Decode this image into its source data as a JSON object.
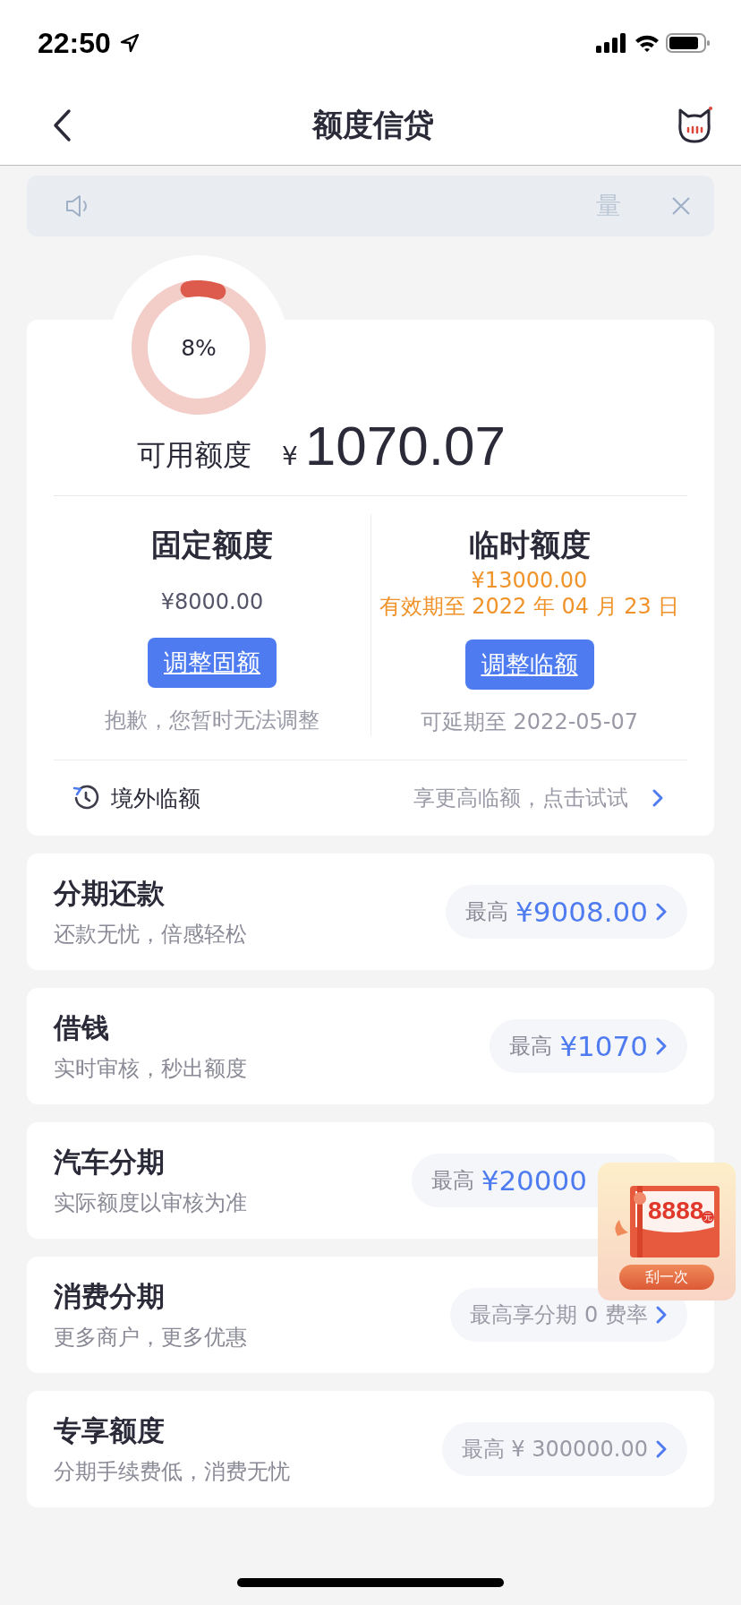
{
  "status_bar": {
    "time": "22:50"
  },
  "nav": {
    "title": "额度信贷"
  },
  "notice": {
    "text": "量"
  },
  "credit": {
    "level": 0.08,
    "percent": "8%",
    "label": "可用额度",
    "currency": "¥",
    "amount": "1070.07"
  },
  "columns": [
    {
      "title": "固定额度",
      "lines": [
        {
          "text": "¥8000.00",
          "kind": "normal"
        }
      ],
      "button": "调整固额",
      "note": "抱歉，您暂时无法调整"
    },
    {
      "title": "临时额度",
      "lines": [
        {
          "text": "¥13000.00",
          "kind": "highlight"
        },
        {
          "text": "有效期至 2022 年 04 月 23 日",
          "kind": "highlight"
        }
      ],
      "button": "调整临额",
      "note": "可延期至 2022-05-07"
    }
  ],
  "overseas": {
    "label": "境外临额",
    "hint": "享更高临额，点击试试"
  },
  "products": [
    {
      "title": "分期还款",
      "subtitle": "还款无忧，倍感轻松",
      "kind": "amount",
      "prefix": "最高",
      "value": "¥9008.00",
      "arrow": true
    },
    {
      "title": "借钱",
      "subtitle": "实时审核，秒出额度",
      "kind": "amount",
      "prefix": "最高",
      "value": "¥1070",
      "arrow": true
    },
    {
      "title": "汽车分期",
      "subtitle": "实际额度以审核为准",
      "kind": "amount",
      "prefix": "最高",
      "value": "¥20000",
      "arrow": false
    },
    {
      "title": "消费分期",
      "subtitle": "更多商户，更多优惠",
      "kind": "text",
      "text": "最高享分期 0 费率",
      "arrow": true
    },
    {
      "title": "专享额度",
      "subtitle": "分期手续费低，消费无忧",
      "kind": "text",
      "text": "最高 ¥ 300000.00",
      "arrow": true
    }
  ],
  "promo": {
    "amount": "8888",
    "unit": "元",
    "button": "刮一次"
  }
}
